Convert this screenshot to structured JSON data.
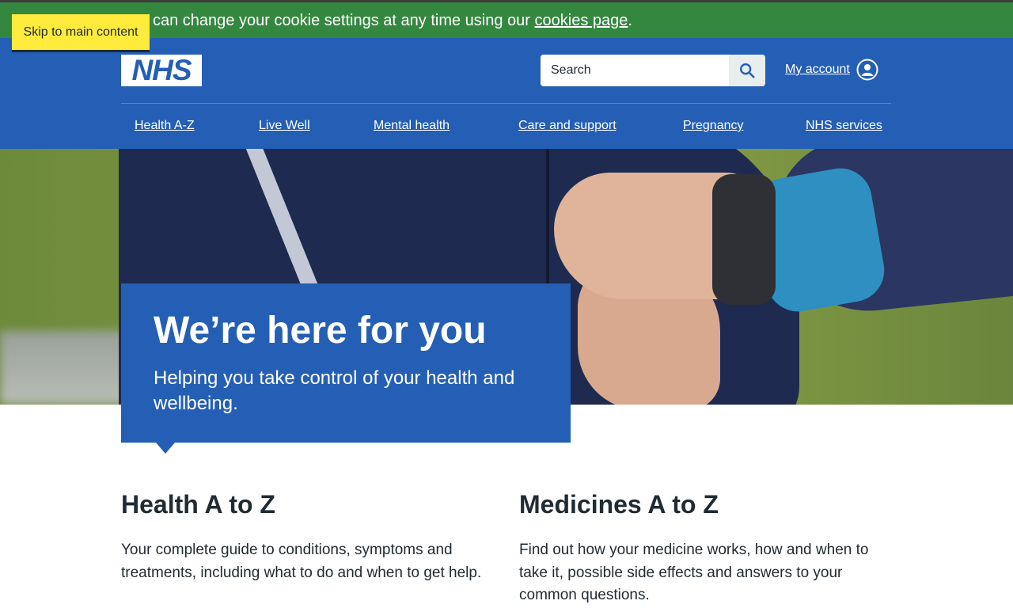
{
  "cookie_banner": {
    "text_before": "can change your cookie settings at any time using our ",
    "link": "cookies page",
    "text_after": "."
  },
  "skip_link": "Skip to main content",
  "header": {
    "logo": "NHS",
    "search": {
      "placeholder": "Search"
    },
    "account": "My account"
  },
  "nav": {
    "items": [
      {
        "label": "Health A-Z"
      },
      {
        "label": "Live Well"
      },
      {
        "label": "Mental health"
      },
      {
        "label": "Care and support"
      },
      {
        "label": "Pregnancy"
      },
      {
        "label": "NHS services"
      }
    ]
  },
  "hero": {
    "title": "We’re here for you",
    "subtitle": "Helping you take control of your health and wellbeing."
  },
  "sections": [
    {
      "title": "Health A to Z",
      "text": "Your complete guide to conditions, symptoms and treatments, including what to do and when to get help."
    },
    {
      "title": "Medicines A to Z",
      "text": "Find out how your medicine works, how and when to take it, possible side effects and answers to your common questions."
    }
  ],
  "colors": {
    "brand_blue": "#245fb5",
    "cookie_green": "#34873f",
    "skip_yellow": "#ffeb3b",
    "text": "#212b32"
  }
}
